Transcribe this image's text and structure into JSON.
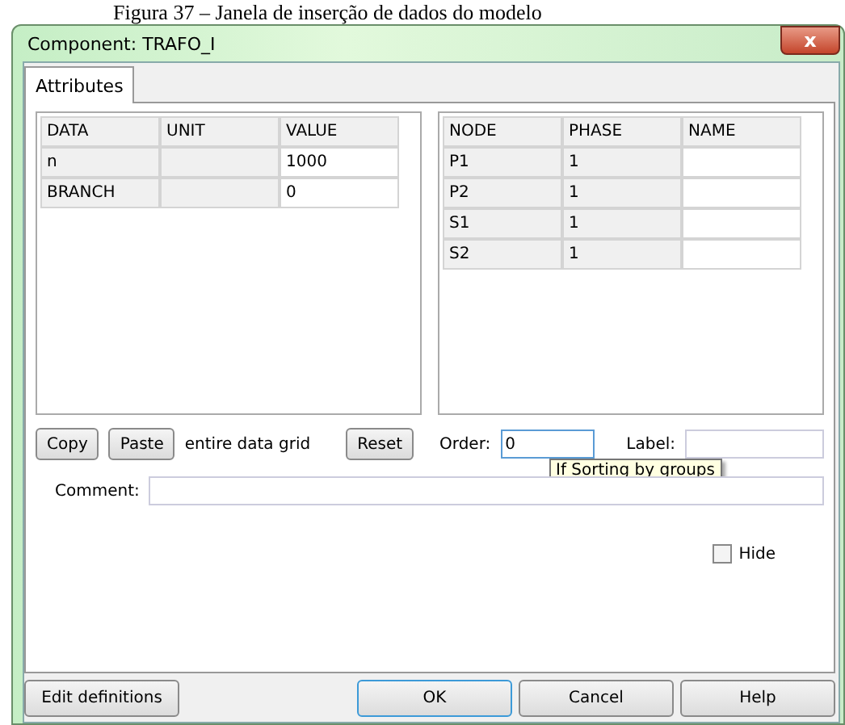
{
  "caption": "Figura 37 – Janela de inserção de dados do modelo",
  "window": {
    "title": "Component: TRAFO_I",
    "close": "x"
  },
  "tabs": [
    {
      "label": "Attributes",
      "selected": true
    }
  ],
  "data_grid": {
    "columns": [
      "DATA",
      "UNIT",
      "VALUE"
    ],
    "rows": [
      [
        "n",
        "",
        "1000"
      ],
      [
        "BRANCH",
        "",
        "0"
      ]
    ]
  },
  "node_grid": {
    "columns": [
      "NODE",
      "PHASE",
      "NAME"
    ],
    "rows": [
      [
        "P1",
        "1",
        ""
      ],
      [
        "P2",
        "1",
        ""
      ],
      [
        "S1",
        "1",
        ""
      ],
      [
        "S2",
        "1",
        ""
      ]
    ]
  },
  "grid_actions": {
    "copy": "Copy",
    "paste": "Paste",
    "note": "entire data grid",
    "reset": "Reset"
  },
  "order": {
    "label": "Order:",
    "value": "0",
    "focused": true,
    "tooltip": "If Sorting by groups"
  },
  "label_field": {
    "label": "Label:"
  },
  "comment": {
    "label": "Comment:"
  },
  "hide": {
    "label": "Hide",
    "checked": false
  },
  "buttons": [
    {
      "label": "Edit definitions",
      "default": false
    },
    {
      "label": "OK",
      "default": true
    },
    {
      "label": "Cancel",
      "default": false
    },
    {
      "label": "Help",
      "default": false
    }
  ]
}
